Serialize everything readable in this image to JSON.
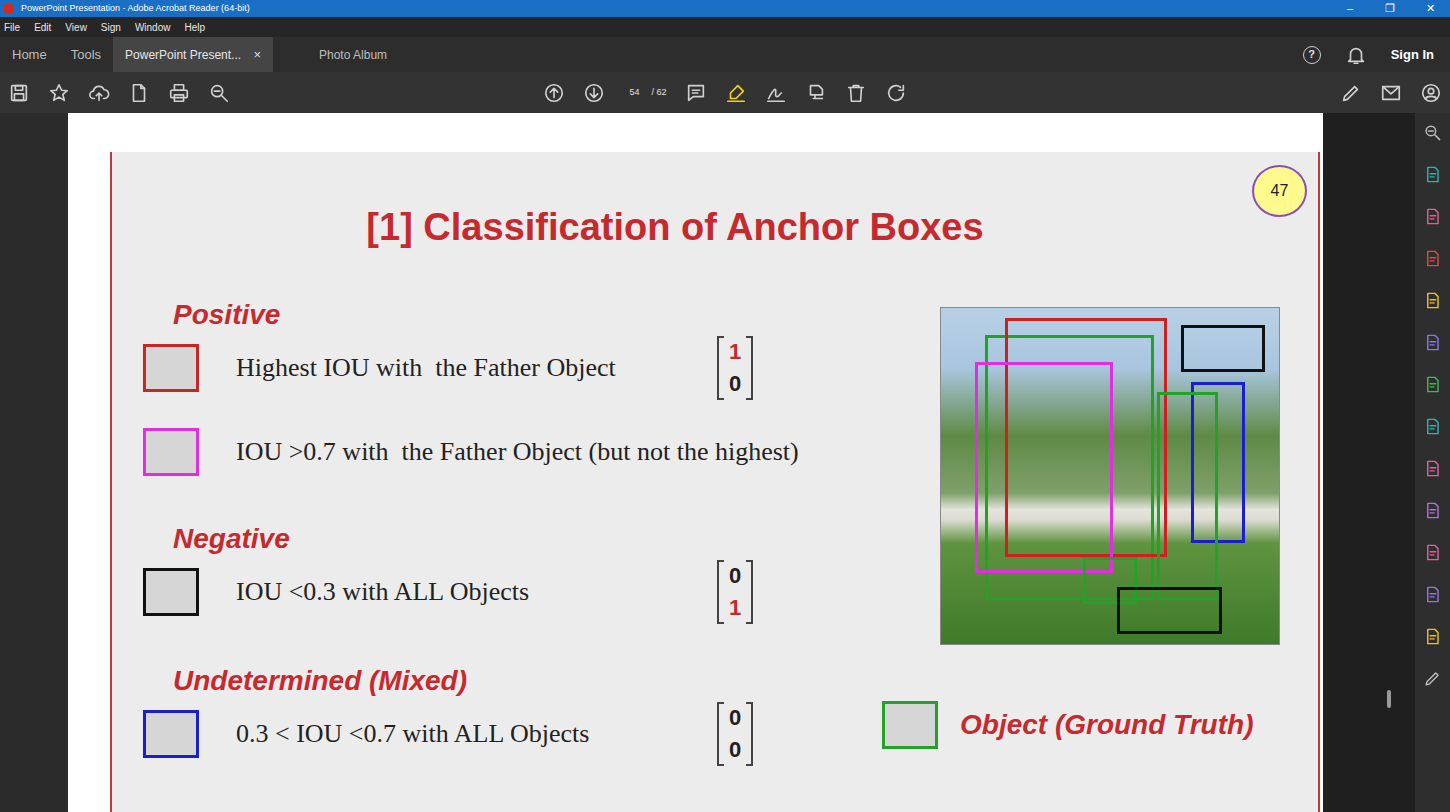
{
  "window": {
    "title": "PowerPoint Presentation - Adobe Acrobat Reader (64-bit)",
    "controls": [
      "–",
      "❐",
      "✕"
    ]
  },
  "menu": [
    "File",
    "Edit",
    "View",
    "Sign",
    "Window",
    "Help"
  ],
  "tabs": [
    {
      "label": "Home",
      "selected": false,
      "closable": false
    },
    {
      "label": "Tools",
      "selected": false,
      "closable": false
    },
    {
      "label": "PowerPoint Present...",
      "selected": true,
      "closable": true
    },
    {
      "label": "Photo Album",
      "selected": false,
      "closable": false
    }
  ],
  "tab_close": "×",
  "account": {
    "help": "?",
    "sign_in": "Sign In"
  },
  "toolbar": {
    "page": "54",
    "total": "/ 62"
  },
  "slide": {
    "number": "47",
    "title": "[1] Classification of Anchor Boxes",
    "groups": [
      {
        "heading": "Positive",
        "vector": [
          {
            "value": "1",
            "hot": true
          },
          {
            "value": "0",
            "hot": false
          }
        ],
        "items": [
          {
            "text": "Highest IOU with  the Father Object",
            "color": "#c62828"
          },
          {
            "text": "IOU >0.7 with  the Father Object (but not the highest)",
            "color": "#e02ee0"
          }
        ]
      },
      {
        "heading": "Negative",
        "vector": [
          {
            "value": "0",
            "hot": false
          },
          {
            "value": "1",
            "hot": true
          }
        ],
        "items": [
          {
            "text": "IOU <0.3 with ALL Objects",
            "color": "#111111"
          }
        ]
      },
      {
        "heading": "Undetermined (Mixed)",
        "vector": [
          {
            "value": "0",
            "hot": false
          },
          {
            "value": "0",
            "hot": false
          }
        ],
        "items": [
          {
            "text": "0.3 < IOU <0.7 with ALL Objects",
            "color": "#1c1cd0"
          }
        ]
      }
    ],
    "legend": {
      "text": "Object (Ground Truth)",
      "color": "#23a12b"
    },
    "figure": {
      "boxes": [
        {
          "color": "#23a12b"
        },
        {
          "color": "#d01f1f"
        },
        {
          "color": "#e02ee0"
        },
        {
          "color": "#111111"
        },
        {
          "color": "#1c1cd0"
        },
        {
          "color": "#23a12b"
        },
        {
          "color": "#23a12b"
        },
        {
          "color": "#111111"
        }
      ]
    }
  }
}
